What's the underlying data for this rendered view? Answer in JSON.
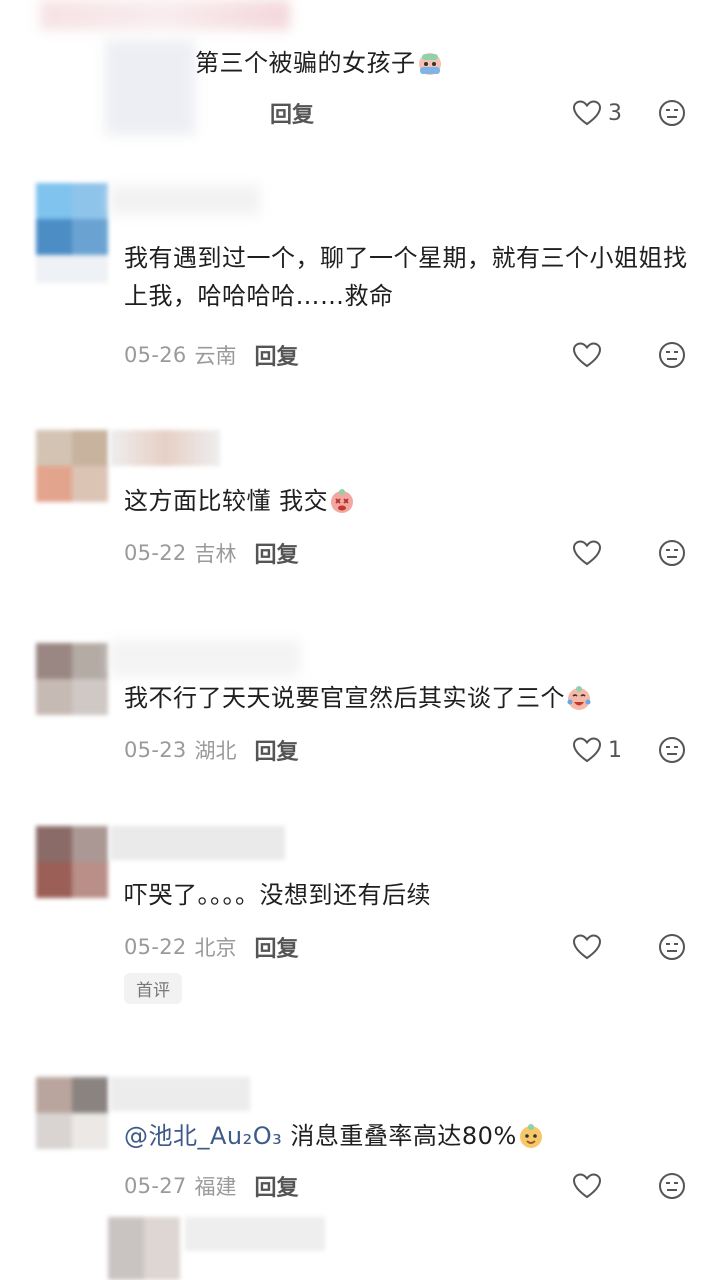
{
  "comments": [
    {
      "text": "第三个被骗的女孩子",
      "date": "",
      "location": "",
      "reply": "回复",
      "likes": "3",
      "emoji": "crying-face-emoji"
    },
    {
      "text": "我有遇到过一个，聊了一个星期，就有三个小姐姐找上我，哈哈哈哈……救命",
      "date": "05-26",
      "location": "云南",
      "reply": "回复",
      "likes": ""
    },
    {
      "text": "这方面比较懂 我交",
      "date": "05-22",
      "location": "吉林",
      "reply": "回复",
      "likes": "",
      "emoji": "dizzy-face-emoji"
    },
    {
      "text": "我不行了天天说要官宣然后其实谈了三个",
      "date": "05-23",
      "location": "湖北",
      "reply": "回复",
      "likes": "1",
      "emoji": "laugh-cry-emoji"
    },
    {
      "text": "吓哭了。。。。没想到还有后续",
      "date": "05-22",
      "location": "北京",
      "reply": "回复",
      "likes": "",
      "badge": "首评"
    },
    {
      "mention": "@池北_Au₂O₃",
      "text": "消息重叠率高达80%",
      "date": "05-27",
      "location": "福建",
      "reply": "回复",
      "likes": "",
      "emoji": "cheeky-face-emoji"
    }
  ],
  "colors": {
    "mention": "#3d5a8a",
    "meta": "#9a9a9a",
    "text": "#1f1f1f"
  }
}
